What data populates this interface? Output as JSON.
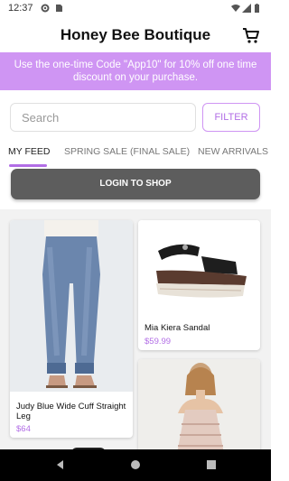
{
  "status_bar": {
    "time": "12:37"
  },
  "header": {
    "title": "Honey Bee Boutique"
  },
  "promo": {
    "text": "Use the one-time Code \"App10\" for 10% off one time discount on your purchase."
  },
  "search": {
    "placeholder": "Search"
  },
  "filter": {
    "label": "FILTER"
  },
  "tabs": [
    {
      "label": "MY FEED"
    },
    {
      "label": "SPRING SALE (FINAL SALE)"
    },
    {
      "label": "NEW ARRIVALS"
    }
  ],
  "login": {
    "label": "LOGIN TO SHOP"
  },
  "products": [
    {
      "name": "Judy Blue Wide Cuff Straight Leg",
      "price": "$64"
    },
    {
      "name": "Mia Kiera Sandal",
      "price": "$59.99"
    },
    {
      "name": "",
      "price": ""
    }
  ],
  "colors": {
    "accent": "#b26ee6",
    "promo_bg": "#cf95f3",
    "login_bg": "#5d5d5d"
  }
}
